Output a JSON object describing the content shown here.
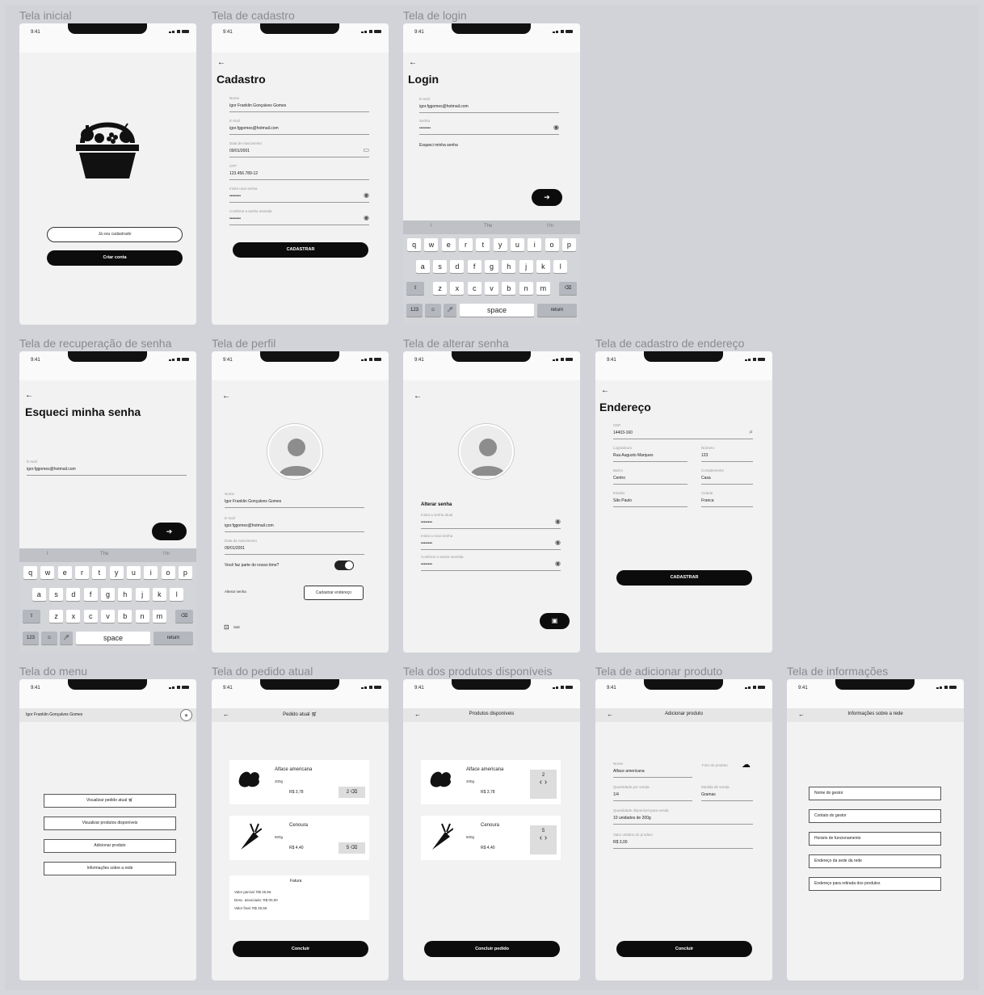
{
  "frames": {
    "inicial": {
      "title": "Tela inicial",
      "time": "9:41",
      "btn_outline": "Já sou cadastrado",
      "btn_black": "Criar conta",
      "icon": "basket-icon"
    },
    "cadastro": {
      "title": "Tela de cadastro",
      "time": "9:41",
      "heading": "Cadastro",
      "fields": [
        {
          "label": "Nome",
          "value": "Igor Franklin Gonçalves Gomes"
        },
        {
          "label": "E-mail",
          "value": "igor.fggomes@hotmail.com"
        },
        {
          "label": "Data de nascimento",
          "value": "09/01/2001"
        },
        {
          "label": "CPF",
          "value": "123.456.789-12"
        },
        {
          "label": "Insira uma senha",
          "value": "••••••••"
        },
        {
          "label": "Confirme a senha inserida",
          "value": "••••••••"
        }
      ],
      "button": "CADASTRAR"
    },
    "login": {
      "title": "Tela de login",
      "time": "9:41",
      "heading": "Login",
      "fields": [
        {
          "label": "E-mail",
          "value": "igor.fggomes@hotmail.com"
        },
        {
          "label": "Senha",
          "value": "••••••••"
        }
      ],
      "forgot": "Esqueci minha senha",
      "suggestions": [
        "I",
        "The",
        "I'm"
      ]
    },
    "recuperacao": {
      "title": "Tela de recuperação de senha",
      "time": "9:41",
      "heading": "Esqueci minha senha",
      "fields": [
        {
          "label": "E-mail",
          "value": "igor.fggomes@hotmail.com"
        }
      ],
      "suggestions": [
        "I",
        "The",
        "I'm"
      ]
    },
    "perfil": {
      "title": "Tela de perfil",
      "time": "9:41",
      "fields": [
        {
          "label": "Nome",
          "value": "Igor Franklin Gonçalves Gomes"
        },
        {
          "label": "E-mail",
          "value": "igor.fggomes@hotmail.com"
        },
        {
          "label": "Data de nascimento",
          "value": "09/01/2001"
        }
      ],
      "toggle_label": "Você faz parte do nosso time?",
      "alterar": "Alterar senha",
      "cad_endereco": "Cadastrar endereço",
      "sair": "Sair"
    },
    "alterar": {
      "title": "Tela de alterar senha",
      "time": "9:41",
      "heading": "Alterar senha",
      "fields": [
        {
          "label": "Insira a senha atual",
          "value": "••••••••"
        },
        {
          "label": "Insira a nova senha",
          "value": "••••••••"
        },
        {
          "label": "Confirme a senha inserida",
          "value": "••••••••"
        }
      ]
    },
    "endereco": {
      "title": "Tela de cadastro de endereço",
      "time": "9:41",
      "heading": "Endereço",
      "cep": {
        "label": "CEP",
        "value": "14403-160"
      },
      "left": [
        {
          "label": "Logradouro",
          "value": "Rua Augusto Marques"
        },
        {
          "label": "Bairro",
          "value": "Centro"
        },
        {
          "label": "Estado",
          "value": "São Paulo"
        }
      ],
      "right": [
        {
          "label": "Número",
          "value": "123"
        },
        {
          "label": "Complemento",
          "value": "Casa"
        },
        {
          "label": "Cidade",
          "value": "Franca"
        }
      ],
      "button": "CADASTRAR"
    },
    "menu": {
      "title": "Tela do menu",
      "time": "9:41",
      "user": "Igor Franklin Gonçalves Gomes",
      "items": [
        "Visualizar pedido atual",
        "Visualizar produtos disponíveis",
        "Adicionar produto",
        "Informações sobre a rede"
      ]
    },
    "pedido": {
      "title": "Tela do pedido atual",
      "time": "9:41",
      "appbar": "Pedido atual",
      "items": [
        {
          "name": "Alface americana",
          "qty": "200g",
          "price": "R$ 3,78",
          "count": "2"
        },
        {
          "name": "Cenoura",
          "qty": "500g",
          "price": "R$ 4,40",
          "count": "5"
        }
      ],
      "fatura": {
        "title": "Fatura",
        "lines": [
          "Valor parcial: R$ 25,56",
          "Desc. associado: R$ 00,00",
          "Valor final: R$ 25,56"
        ]
      },
      "button": "Concluir"
    },
    "produtos": {
      "title": "Tela dos produtos disponíveis",
      "time": "9:41",
      "appbar": "Produtos disponíveis",
      "items": [
        {
          "name": "Alface americana",
          "qty": "200g",
          "price": "R$ 3,78",
          "count": "2"
        },
        {
          "name": "Cenoura",
          "qty": "500g",
          "price": "R$ 4,40",
          "count": "5"
        }
      ],
      "button": "Concluir pedido"
    },
    "adicionar": {
      "title": "Tela de adicionar produto",
      "time": "9:41",
      "appbar": "Adicionar produto",
      "fields": [
        {
          "label": "Nome",
          "value": "Alface americana"
        },
        {
          "label": "Quantidade por venda",
          "value": "1/4"
        },
        {
          "label": "Quantidade disponível para venda",
          "value": "10 unidades de 200g"
        },
        {
          "label": "Valor unitário do produto",
          "value": "R$ 3,00"
        }
      ],
      "foto": "Foto do produto",
      "medida": {
        "label": "Medida de venda",
        "value": "Gramas"
      },
      "button": "Concluir"
    },
    "info": {
      "title": "Tela de informações",
      "time": "9:41",
      "appbar": "Informações sobre a rede",
      "items": [
        "Nome do gestor",
        "Contato do gestor",
        "Horário de funcionamento",
        "Endereço da sede da rede",
        "Endereço para retirada dos produtos"
      ]
    }
  },
  "keyboard": {
    "row1": [
      "q",
      "w",
      "e",
      "r",
      "t",
      "y",
      "u",
      "i",
      "o",
      "p"
    ],
    "row2": [
      "a",
      "s",
      "d",
      "f",
      "g",
      "h",
      "j",
      "k",
      "l"
    ],
    "row3": [
      "z",
      "x",
      "c",
      "v",
      "b",
      "n",
      "m"
    ],
    "space": "space",
    "num": "123",
    "ret_login": "return",
    "ret_rec": "return"
  },
  "colors": {
    "background": "#d2d3d8",
    "screen": "#f2f2f2",
    "accent": "#0c0c0c"
  }
}
